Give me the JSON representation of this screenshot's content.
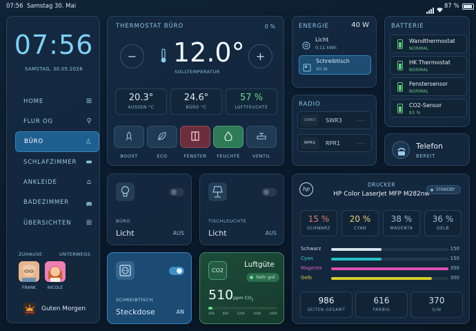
{
  "status_bar": {
    "time": "07:56",
    "date": "Samstag 30. Mai",
    "battery": "87 %"
  },
  "sidebar": {
    "clock": "07:56",
    "date": "SAMSTAG, 30.05.2026",
    "nav": [
      {
        "label": "HOME",
        "icon": "grid-icon"
      },
      {
        "label": "FLUR OG",
        "icon": "coat-hanger-icon"
      },
      {
        "label": "BÜRO",
        "icon": "office-chair-icon",
        "active": true
      },
      {
        "label": "SCHLAFZIMMER",
        "icon": "bed-icon"
      },
      {
        "label": "ANKLEIDE",
        "icon": "hanger-icon"
      },
      {
        "label": "BADEZIMMER",
        "icon": "bathtub-icon"
      },
      {
        "label": "ÜBERSICHTEN",
        "icon": "grid-icon"
      }
    ],
    "presence": {
      "home_label": "ZUHAUSE",
      "away_label": "UNTERWEGS",
      "people": [
        {
          "name": "FRANK"
        },
        {
          "name": "NICOLE"
        }
      ]
    },
    "greeting": "Guten Morgen"
  },
  "thermostat": {
    "title": "THERMOSTAT BÜRO",
    "percent": "0 %",
    "value": "12.0°",
    "setpoint_label": "SOLLTEMPERATUR",
    "stats": [
      {
        "value": "20.3°",
        "label": "AUSSEN °C"
      },
      {
        "value": "24.6°",
        "label": "BÜRO °C"
      },
      {
        "value": "57 %",
        "label": "LUFTFEUCHTE"
      }
    ],
    "modes": [
      {
        "label": "BOOST"
      },
      {
        "label": "ECO"
      },
      {
        "label": "FENSTER"
      },
      {
        "label": "FEUCHTE"
      },
      {
        "label": "VENTIL"
      }
    ]
  },
  "energy": {
    "title": "ENERGIE",
    "total": "40 W",
    "items": [
      {
        "name": "Licht",
        "value": "0.11 kWh"
      },
      {
        "name": "Schreibtisch",
        "value": "40 W"
      }
    ]
  },
  "radio": {
    "title": "RADIO",
    "stations": [
      {
        "logo": "SWR3",
        "name": "SWR3",
        "dots": "....."
      },
      {
        "logo": "RPR1",
        "name": "RPR1",
        "dots": "....."
      }
    ]
  },
  "battery": {
    "title": "BATTERIE",
    "items": [
      {
        "name": "Wandthermostat",
        "status": "NORMAL"
      },
      {
        "name": "HK Thermostat",
        "status": "NORMAL"
      },
      {
        "name": "Fenstersensor",
        "status": "NORMAL"
      },
      {
        "name": "CO2-Sensor",
        "status": "93 %"
      }
    ]
  },
  "telefon": {
    "name": "Telefon",
    "status": "BEREIT"
  },
  "tiles": [
    {
      "room": "BÜRO",
      "name": "Licht",
      "state": "AUS"
    },
    {
      "room": "TISCHLEUCHTE",
      "name": "Licht",
      "state": "AUS"
    },
    {
      "room": "SCHREIBTISCH",
      "name": "Steckdose",
      "state": "AN"
    }
  ],
  "air": {
    "title": "Luftgüte",
    "badge": "Sehr gut",
    "icon_label": "CO2",
    "value": "510",
    "unit": "ppm CO",
    "unit_sub": "2",
    "scale": [
      "400",
      "800",
      "1200",
      "1600",
      "2000"
    ],
    "fraction": 0.03
  },
  "printer": {
    "section": "DRUCKER",
    "model": "HP Color LaserJet MFP M282nw",
    "logo": "hp",
    "status": "STANDBY",
    "inks": [
      {
        "value": "15 %",
        "label": "SCHWARZ",
        "color": "#e07a7a"
      },
      {
        "value": "20 %",
        "label": "CYAN",
        "color": "#e8d27a"
      },
      {
        "value": "38 %",
        "label": "MAGENTA",
        "color": "#9dbbd6"
      },
      {
        "value": "36 %",
        "label": "GELB",
        "color": "#9dbbd6"
      }
    ],
    "counts": [
      {
        "name": "Schwarz",
        "value": "150",
        "fraction": 0.43,
        "color": "#d9e3ec",
        "label_color": "#cfdbe6"
      },
      {
        "name": "Cyan",
        "value": "150",
        "fraction": 0.43,
        "color": "#26c0c8",
        "label_color": "#40d0d8"
      },
      {
        "name": "Magenta",
        "value": "350",
        "fraction": 1.0,
        "color": "#e04fb2",
        "label_color": "#e060c0"
      },
      {
        "name": "Gelb",
        "value": "300",
        "fraction": 0.86,
        "color": "#d8cf2a",
        "label_color": "#e0cf40"
      }
    ],
    "totals": [
      {
        "value": "986",
        "label": "SEITEN GESAMT"
      },
      {
        "value": "616",
        "label": "FARBIG"
      },
      {
        "value": "370",
        "label": "S/W"
      }
    ]
  }
}
